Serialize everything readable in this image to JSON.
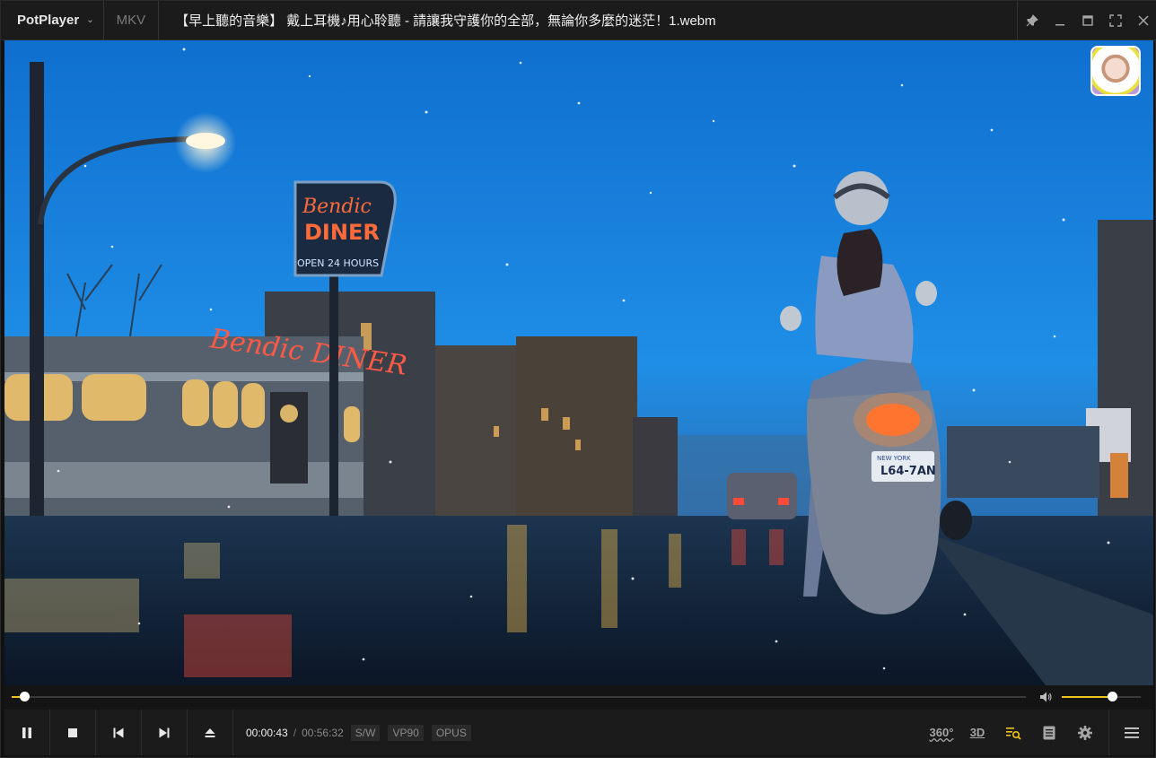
{
  "titlebar": {
    "app_name": "PotPlayer",
    "format": "MKV",
    "title": "【早上聽的音樂】 戴上耳機♪用心聆聽 - 請讓我守護你的全部，無論你多麼的迷茫！1.webm"
  },
  "video": {
    "sign_upper_line1": "Bendic",
    "sign_upper_line2": "DINER",
    "sign_upper_line3": "OPEN 24 HOURS",
    "sign_diner": "Bendic DINER",
    "license_plate": "L64-7AN",
    "plate_state": "NEW YORK"
  },
  "playback": {
    "progress": 0.0127,
    "volume": 0.64
  },
  "controls": {
    "current_time": "00:00:43",
    "separator": "/",
    "duration": "00:56:32",
    "tags": [
      "S/W",
      "VP90",
      "OPUS"
    ],
    "btn_360": "360°",
    "btn_3d": "3D"
  },
  "colors": {
    "accent": "#f0c419",
    "titlebar_bg": "#1b1b1b"
  }
}
